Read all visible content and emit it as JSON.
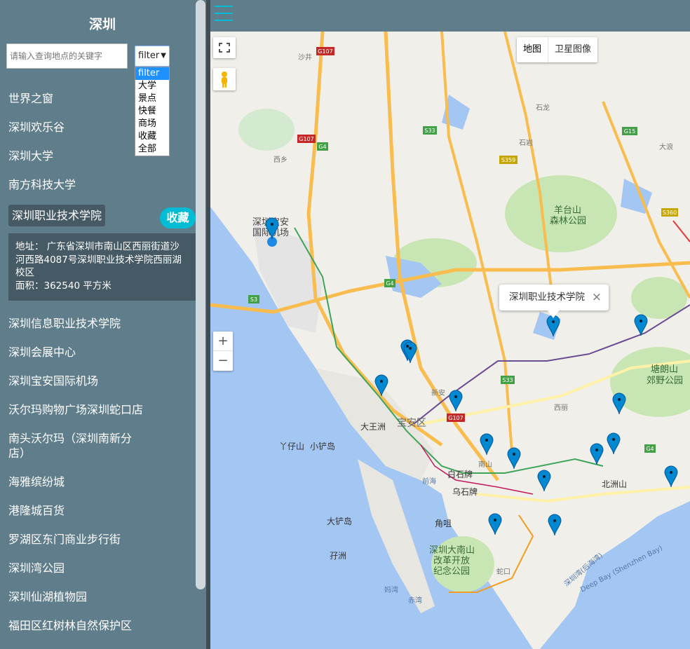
{
  "sidebar": {
    "title": "深圳",
    "search_placeholder": "请输入查询地点的关键字",
    "filter": {
      "selected": "filter",
      "options": [
        "filter",
        "大学",
        "景点",
        "快餐",
        "商场",
        "收藏",
        "全部"
      ]
    },
    "places": [
      "世界之窗",
      "深圳欢乐谷",
      "深圳大学",
      "南方科技大学",
      "深圳职业技术学院",
      "深圳信息职业技术学院",
      "深圳会展中心",
      "深圳宝安国际机场",
      "沃尔玛购物广场深圳蛇口店",
      "南头沃尔玛（深圳南新分店）",
      "海雅缤纷城",
      "港隆城百货",
      "罗湖区东门商业步行街",
      "深圳湾公园",
      "深圳仙湖植物园",
      "福田区红树林自然保护区"
    ],
    "active_place": "深圳职业技术学院",
    "favorite_label": "收藏",
    "detail": {
      "address": "地址： 广东省深圳市南山区西丽街道沙河西路4087号深圳职业技术学院西丽湖校区",
      "area": "面积：362540 平方米"
    }
  },
  "map": {
    "type_buttons": [
      "地图",
      "卫星图像"
    ],
    "zoom_in": "+",
    "zoom_out": "−",
    "infowindow": {
      "title": "深圳职业技术学院",
      "close": "×"
    },
    "labels": [
      "羊台山",
      "森林公园",
      "深圳宝安",
      "国际机场",
      "塘朗山",
      "郊野公园",
      "宝安区",
      "大王洲",
      "丫仔山",
      "小铲岛",
      "白石牌",
      "乌石牌",
      "北洲山",
      "大铲岛",
      "角咀",
      "孖洲",
      "深圳大南山",
      "改革开放",
      "纪念公园",
      "深圳湾(后海湾)",
      "Deep Bay (Shenzhen Bay)",
      "石岩",
      "西丽",
      "新安",
      "南山",
      "前海",
      "蛇口",
      "妈湾",
      "赤湾",
      "石龙",
      "大浪",
      "西乡",
      "沙井"
    ],
    "road_shields": [
      "G107",
      "G4",
      "S33",
      "G15",
      "S359",
      "S3",
      "S360",
      "G107",
      "G4",
      "S33",
      "G107",
      "G4"
    ]
  },
  "colors": {
    "sidebar_bg": "#607d8b",
    "accent": "#00bcd4",
    "marker": "#0288d1",
    "water": "#a4c6f2",
    "land": "#f1efe9",
    "park": "#c8e6b4"
  }
}
